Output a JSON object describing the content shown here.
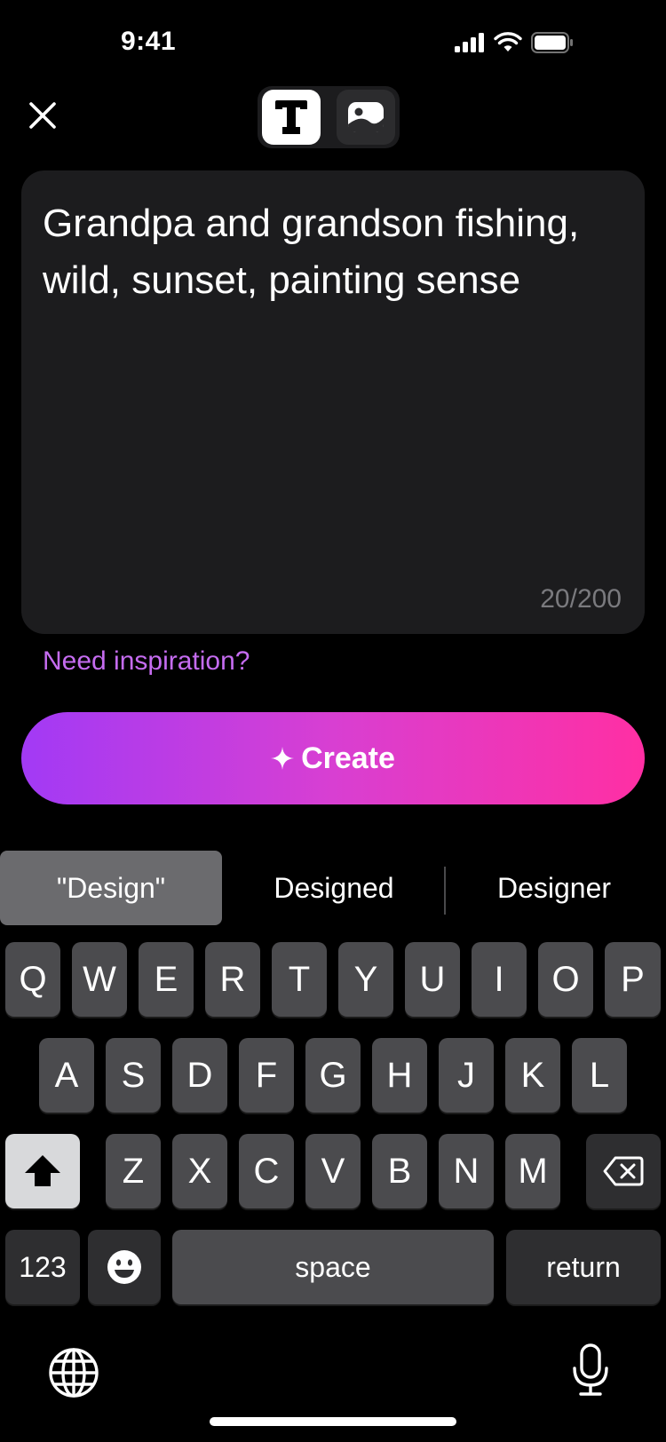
{
  "status_bar": {
    "time": "9:41"
  },
  "top_bar": {
    "close_icon": "close-icon",
    "modes": [
      {
        "label": "Text",
        "icon": "text-icon",
        "active": true
      },
      {
        "label": "Image",
        "icon": "image-icon",
        "active": false
      }
    ]
  },
  "prompt": {
    "text": "Grandpa and grandson fishing,\nwild, sunset, painting sense",
    "char_count": "20/200"
  },
  "inspiration_link": "Need inspiration?",
  "create_button": {
    "label": "Create",
    "icon": "sparkle-icon"
  },
  "colors": {
    "accent_start": "#a23af5",
    "accent_end": "#ff2fa3",
    "link": "#c56cf0"
  },
  "keyboard": {
    "suggestions": [
      "\"Design\"",
      "Designed",
      "Designer"
    ],
    "row1": [
      "Q",
      "W",
      "E",
      "R",
      "T",
      "Y",
      "U",
      "I",
      "O",
      "P"
    ],
    "row2": [
      "A",
      "S",
      "D",
      "F",
      "G",
      "H",
      "J",
      "K",
      "L"
    ],
    "row3": [
      "Z",
      "X",
      "C",
      "V",
      "B",
      "N",
      "M"
    ],
    "numbers_key": "123",
    "space_key": "space",
    "return_key": "return"
  }
}
